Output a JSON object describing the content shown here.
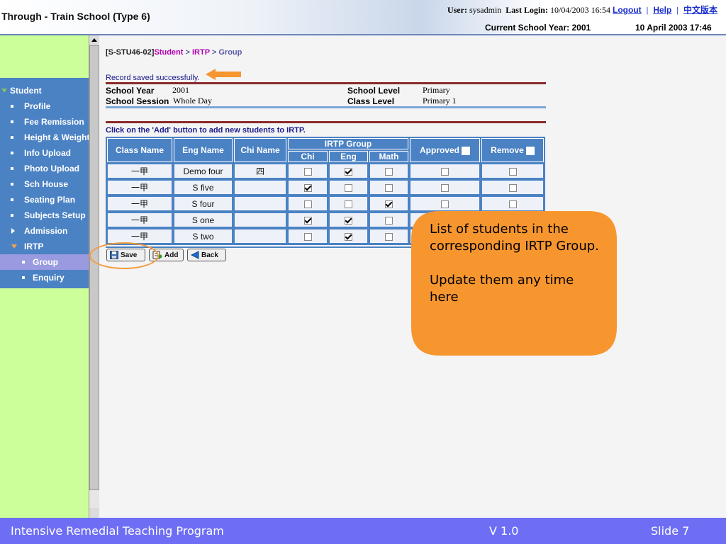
{
  "header": {
    "title": "Through - Train School (Type 6)",
    "user_label": "User:",
    "user": "sysadmin",
    "last_login_label": "Last Login:",
    "last_login": "10/04/2003 16:54",
    "logout": "Logout",
    "help": "Help",
    "chinese": "中文版本",
    "school_year": "Current School Year: 2001",
    "datetime": "10 April 2003 17:46"
  },
  "sidebar": {
    "section": "Student",
    "items": [
      {
        "label": "Profile"
      },
      {
        "label": "Fee Remission"
      },
      {
        "label": "Height & Weight"
      },
      {
        "label": "Info Upload"
      },
      {
        "label": "Photo Upload"
      },
      {
        "label": "Sch House"
      },
      {
        "label": "Seating Plan"
      },
      {
        "label": "Subjects Setup"
      },
      {
        "label": "Admission"
      },
      {
        "label": "IRTP"
      }
    ],
    "subitems": [
      {
        "label": "Group"
      },
      {
        "label": "Enquiry"
      }
    ]
  },
  "breadcrumb": {
    "code": "[S-STU46-02]",
    "student": "Student",
    "sep1": " > ",
    "irtp": "IRTP",
    "sep2": " > ",
    "group": "Group"
  },
  "message": "Record saved successfully.",
  "info": {
    "school_year_label": "School Year",
    "school_year": "2001",
    "school_session_label": "School Session",
    "school_session": "Whole Day",
    "school_level_label": "School Level",
    "school_level": "Primary",
    "class_level_label": "Class Level",
    "class_level": "Primary 1"
  },
  "instruction": "Click on the 'Add' button to add new students to IRTP.",
  "table": {
    "headers": {
      "class_name": "Class Name",
      "eng_name": "Eng Name",
      "chi_name": "Chi Name",
      "irtp_group": "IRTP Group",
      "chi": "Chi",
      "eng": "Eng",
      "math": "Math",
      "approved": "Approved",
      "remove": "Remove"
    },
    "rows": [
      {
        "class": "一甲",
        "eng": "Demo four",
        "chi_name": "四",
        "c": false,
        "e": true,
        "m": false,
        "approved": false,
        "remove": false
      },
      {
        "class": "一甲",
        "eng": "S five",
        "chi_name": "",
        "c": true,
        "e": false,
        "m": false,
        "approved": false,
        "remove": false
      },
      {
        "class": "一甲",
        "eng": "S four",
        "chi_name": "",
        "c": false,
        "e": false,
        "m": true,
        "approved": false,
        "remove": false
      },
      {
        "class": "一甲",
        "eng": "S one",
        "chi_name": "",
        "c": true,
        "e": true,
        "m": false,
        "approved": false,
        "remove": false
      },
      {
        "class": "一甲",
        "eng": "S two",
        "chi_name": "",
        "c": false,
        "e": true,
        "m": false,
        "approved": false,
        "remove": false
      }
    ]
  },
  "buttons": {
    "save": "Save",
    "add": "Add",
    "back": "Back"
  },
  "callout": "List of students in the corresponding IRTP Group.\n\nUpdate them any time here",
  "footer": {
    "program": "Intensive Remedial Teaching Program",
    "version": "V 1.0",
    "slide": "Slide 7"
  },
  "colors": {
    "nav_blue": "#4b82c4",
    "sidebar_green": "#ccff99",
    "callout_orange": "#f7962f",
    "footer_purple": "#6e6ef5"
  }
}
